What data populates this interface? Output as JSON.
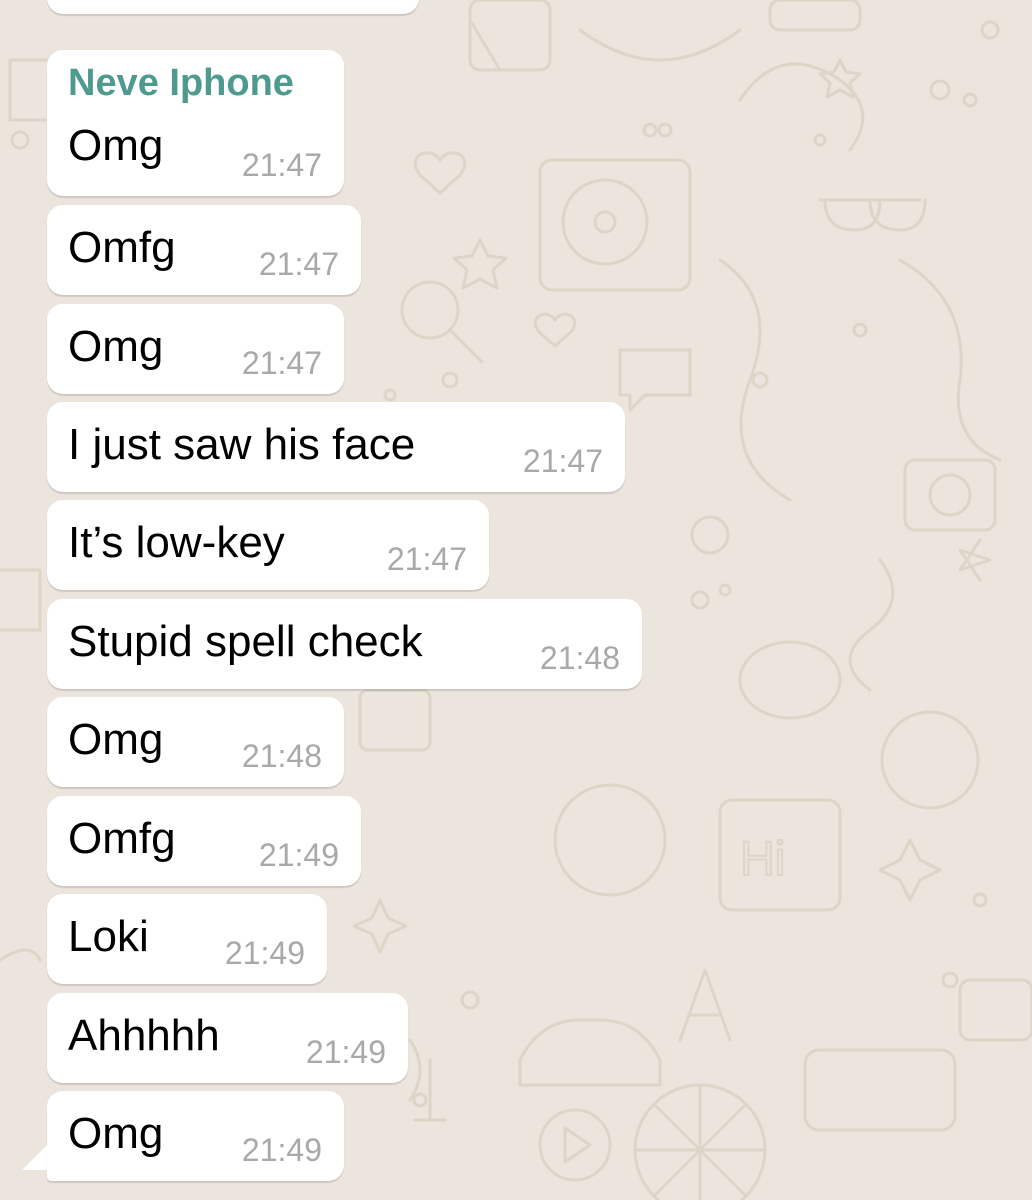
{
  "chat": {
    "sender_name": "Neve Iphone",
    "messages": [
      {
        "text": "Omg",
        "time": "21:47"
      },
      {
        "text": "Omfg",
        "time": "21:47"
      },
      {
        "text": "Omg",
        "time": "21:47"
      },
      {
        "text": "I just saw his face",
        "time": "21:47"
      },
      {
        "text": "It’s low-key",
        "time": "21:47"
      },
      {
        "text": "Stupid spell check",
        "time": "21:48"
      },
      {
        "text": "Omg",
        "time": "21:48"
      },
      {
        "text": "Omfg",
        "time": "21:49"
      },
      {
        "text": "Loki",
        "time": "21:49"
      },
      {
        "text": "Ahhhhh",
        "time": "21:49"
      },
      {
        "text": "Omg",
        "time": "21:49"
      }
    ]
  },
  "colors": {
    "background": "#ece5dd",
    "bubble": "#ffffff",
    "sender_name": "#4f9a8e",
    "timestamp": "#a9a9a9"
  }
}
